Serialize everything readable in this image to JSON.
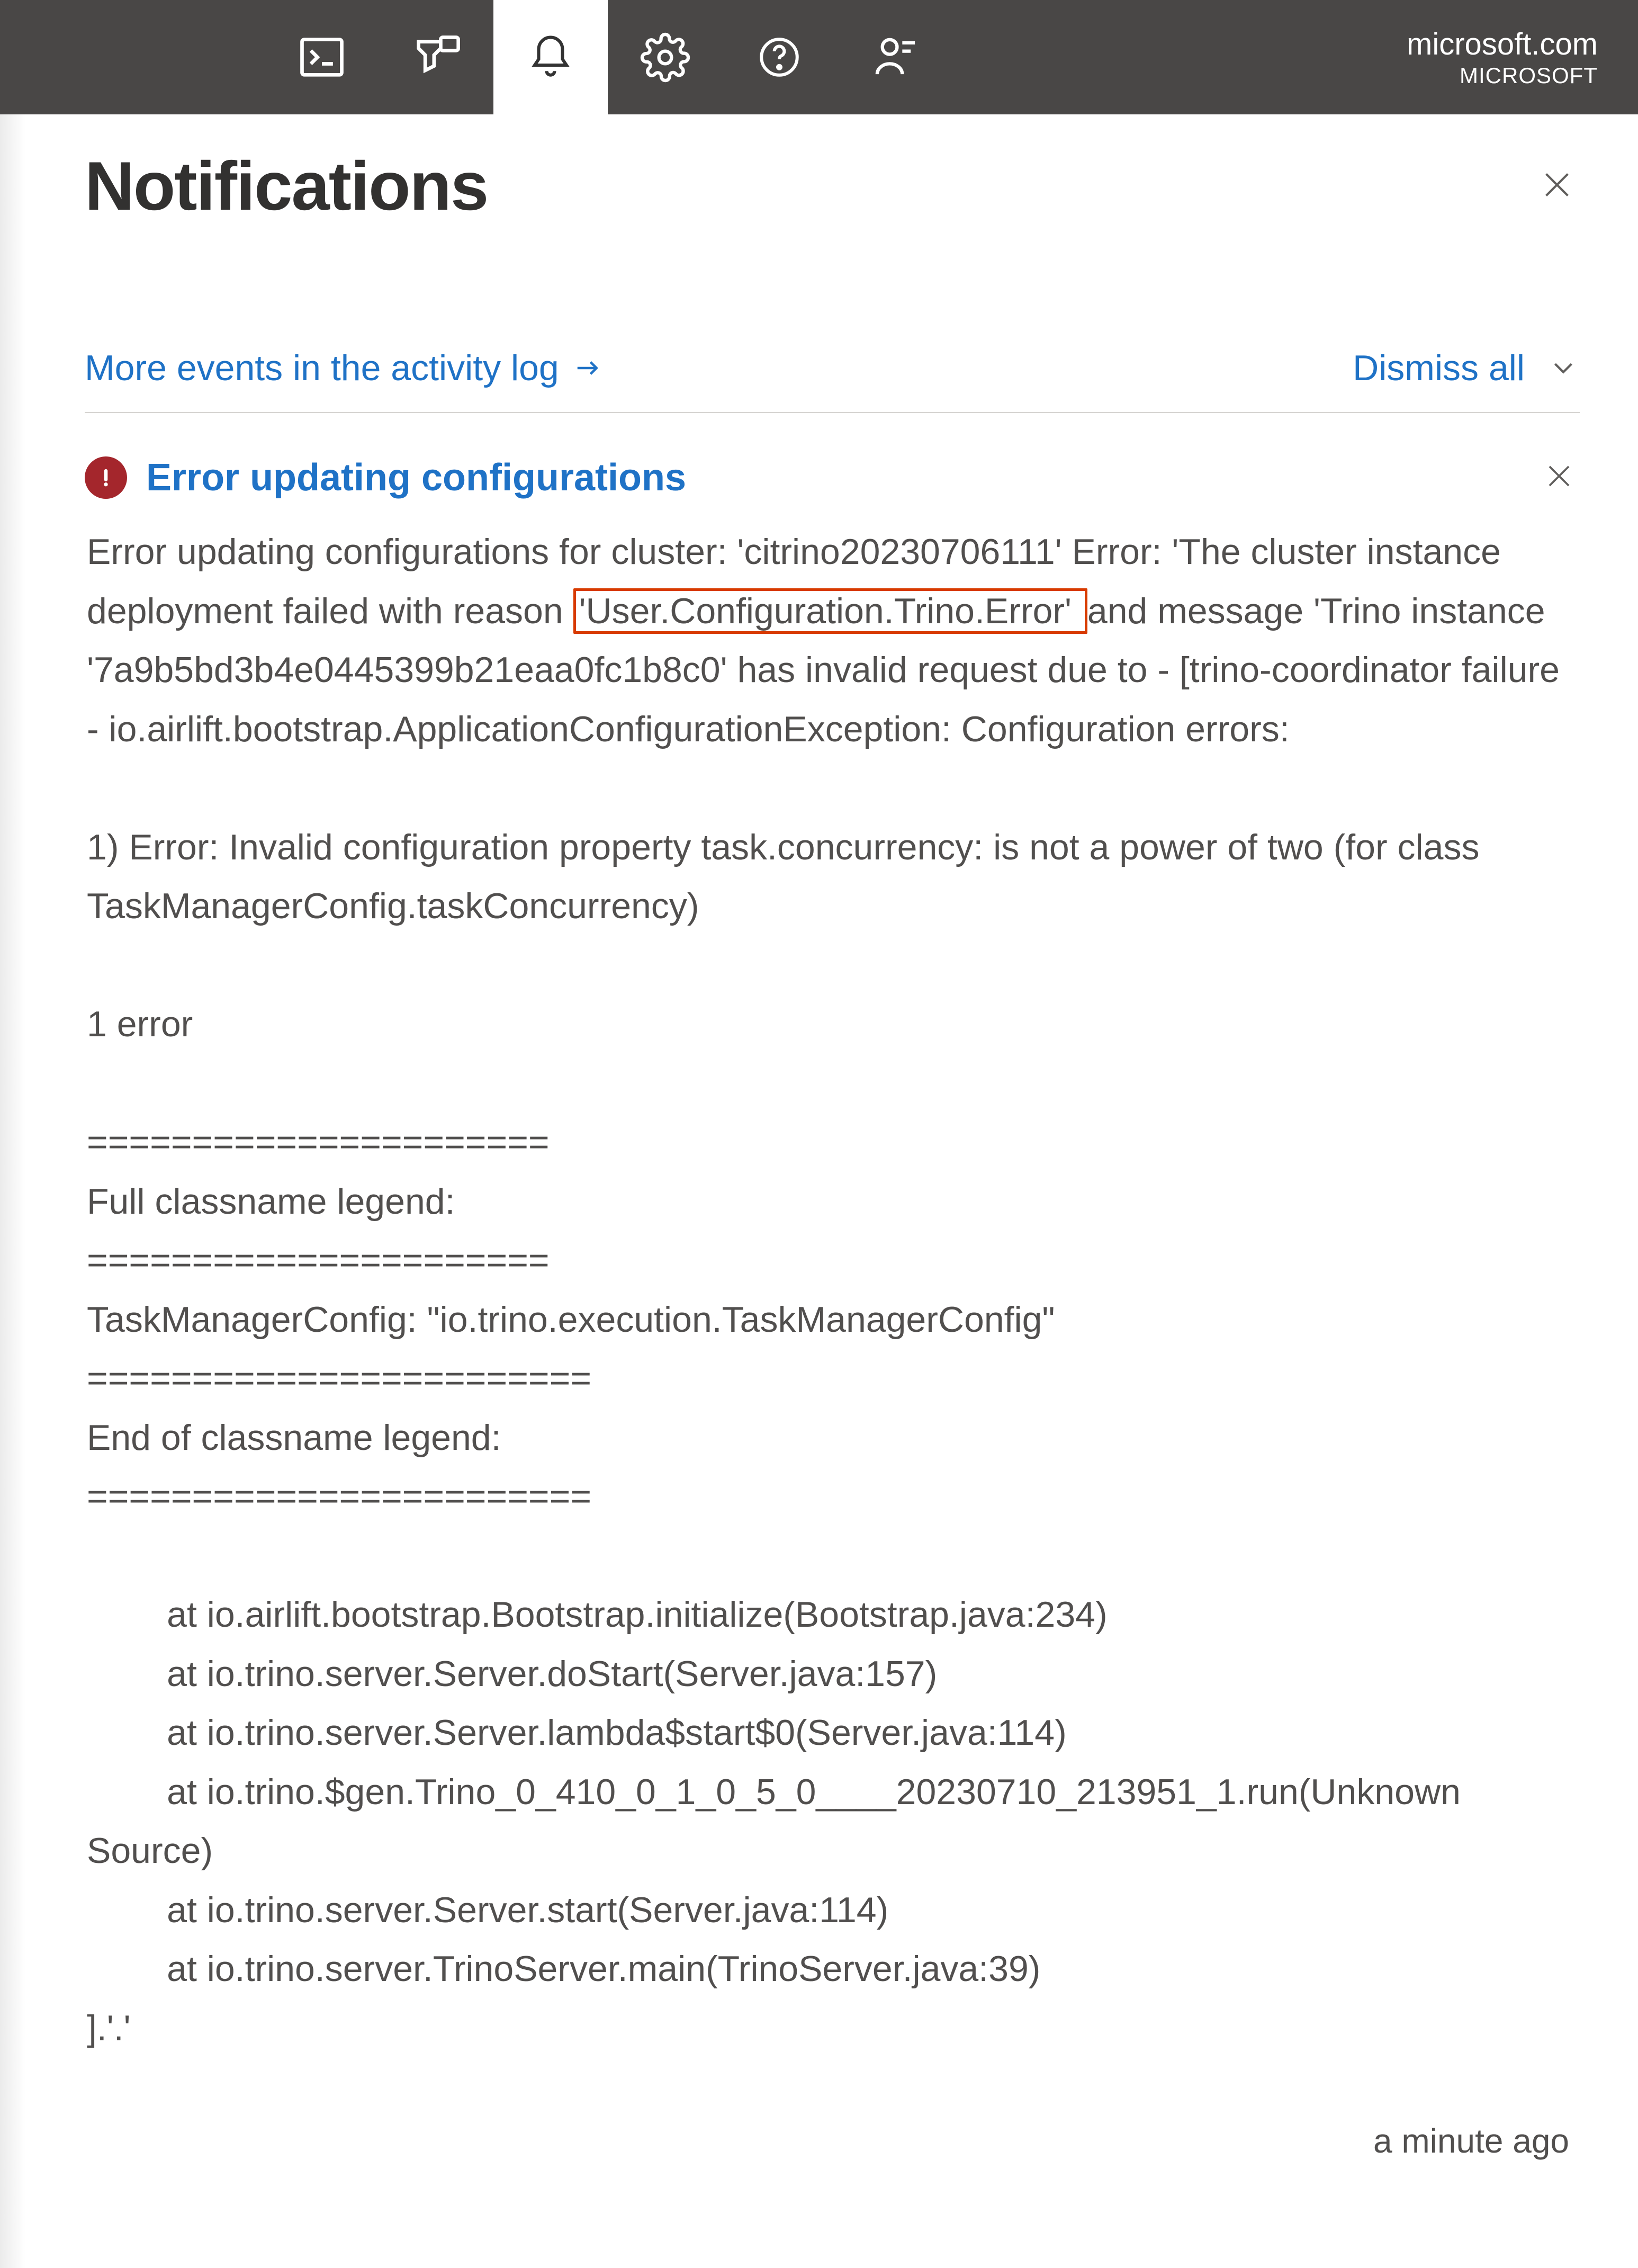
{
  "topbar": {
    "domain": "microsoft.com",
    "org": "MICROSOFT"
  },
  "panel": {
    "title": "Notifications",
    "activity_link": "More events in the activity log",
    "dismiss_all": "Dismiss all"
  },
  "notification": {
    "title": "Error updating configurations",
    "body_pre": "Error updating configurations for cluster: 'citrino20230706111' Error: 'The cluster instance deployment failed with reason ",
    "body_highlight": "'User.Configuration.Trino.Error' ",
    "body_post": "and message 'Trino instance '7a9b5bd3b4e0445399b21eaa0fc1b8c0' has invalid request due to - [trino-coordinator failure - io.airlift.bootstrap.ApplicationConfigurationException: Configuration errors:\n\n1) Error: Invalid configuration property task.concurrency: is not a power of two (for class TaskManagerConfig.taskConcurrency)\n\n1 error\n\n======================\nFull classname legend:\n======================\nTaskManagerConfig: \"io.trino.execution.TaskManagerConfig\"\n========================\nEnd of classname legend:\n========================\n\n        at io.airlift.bootstrap.Bootstrap.initialize(Bootstrap.java:234)\n        at io.trino.server.Server.doStart(Server.java:157)\n        at io.trino.server.Server.lambda$start$0(Server.java:114)\n        at io.trino.$gen.Trino_0_410_0_1_0_5_0____20230710_213951_1.run(Unknown Source)\n        at io.trino.server.Server.start(Server.java:114)\n        at io.trino.server.TrinoServer.main(TrinoServer.java:39)\n].'.'",
    "timestamp": "a minute ago"
  }
}
